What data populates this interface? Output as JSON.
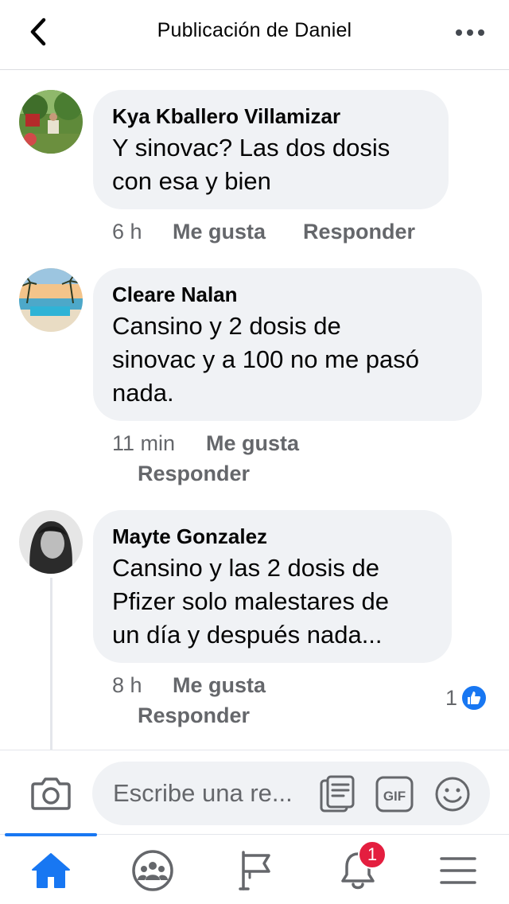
{
  "header": {
    "title": "Publicación de Daniel",
    "back_icon": "chevron-left-icon",
    "more_icon": "more-dots-icon"
  },
  "comments": [
    {
      "author": "Kya Kballero Villamizar",
      "lines": [
        "Y sinovac? Las dos dosis",
        "con esa y bien"
      ],
      "time": "6 h",
      "like_label": "Me gusta",
      "reply_label": "Responder"
    },
    {
      "author": "Cleare Nalan",
      "lines": [
        "Cansino y 2 dosis de",
        "sinovac y a 100 no me pasó",
        "nada."
      ],
      "time": "11 min",
      "like_label": "Me gusta",
      "reply_label": "Responder"
    },
    {
      "author": "Mayte Gonzalez",
      "lines": [
        "Cansino y las 2 dosis de",
        "Pfizer solo malestares de",
        "un día y después nada..."
      ],
      "time": "8 h",
      "like_label": "Me gusta",
      "reply_label": "Responder",
      "reaction_count": "1"
    }
  ],
  "composer": {
    "placeholder": "Escribe una re..."
  },
  "nav": {
    "items": [
      "home-icon",
      "groups-icon",
      "pages-flag-icon",
      "notifications-bell-icon",
      "menu-icon"
    ],
    "notification_badge": "1"
  },
  "colors": {
    "accent": "#1877f2",
    "bubble": "#f0f2f5",
    "muted_text": "#65676b",
    "badge": "#e41e3f"
  }
}
